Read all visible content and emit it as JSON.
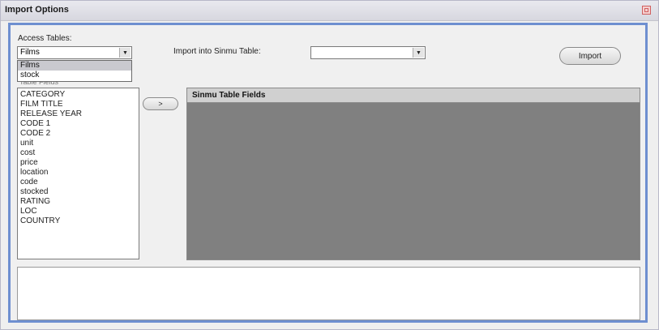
{
  "window": {
    "title": "Import Options"
  },
  "access_tables": {
    "label": "Access Tables:",
    "selected": "Films",
    "options": [
      "Films",
      "stock"
    ]
  },
  "import_into": {
    "label": "Import into Sinmu Table:",
    "selected": ""
  },
  "buttons": {
    "import": "Import",
    "arrow": ">"
  },
  "behind_text": "Table Fields",
  "fields": [
    "CATEGORY",
    "FILM TITLE",
    "RELEASE YEAR",
    "CODE 1",
    "CODE 2",
    "unit",
    "cost",
    "price",
    "location",
    "code",
    "stocked",
    "RATING",
    "LOC",
    "COUNTRY"
  ],
  "grid": {
    "header": "Sinmu Table Fields"
  },
  "colors": {
    "frame_border": "#6e8fd0",
    "grid_bg": "#808080",
    "dropdown_selected": "#c9c9cf"
  }
}
